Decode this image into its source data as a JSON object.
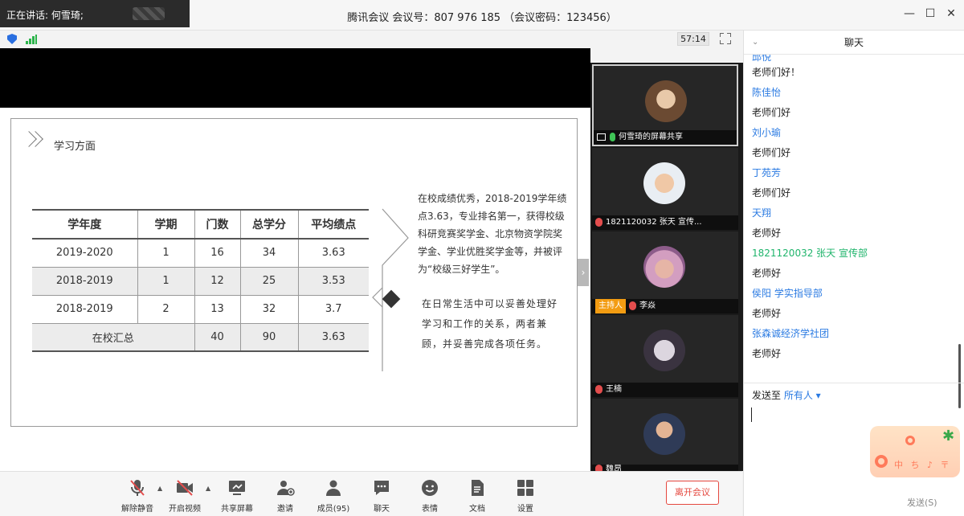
{
  "titlebar": {
    "speaking": "正在讲话: 何雪琦;",
    "meeting_title": "腾讯会议 会议号：807 976 185 （会议密码：123456）",
    "min_icon": "—",
    "max_icon": "☐",
    "close_icon": "✕"
  },
  "infobar": {
    "timer": "57:14"
  },
  "slide": {
    "section_title": "学习方面",
    "table": {
      "headers": [
        "学年度",
        "学期",
        "门数",
        "总学分",
        "平均绩点"
      ],
      "rows": [
        [
          "2019-2020",
          "1",
          "16",
          "34",
          "3.63"
        ],
        [
          "2018-2019",
          "1",
          "12",
          "25",
          "3.53"
        ],
        [
          "2018-2019",
          "2",
          "13",
          "32",
          "3.7"
        ]
      ],
      "summary": {
        "label": "在校汇总",
        "courses": "40",
        "credits": "90",
        "gpa": "3.63"
      }
    },
    "paragraph1": "在校成绩优秀，2018-2019学年绩点3.63，专业排名第一，获得校级科研竞赛奖学金、北京物资学院奖学金、学业优胜奖学金等，并被评为“校级三好学生”。",
    "paragraph2": "在日常生活中可以妥善处理好学习和工作的关系，两者兼顾，并妥善完成各项任务。",
    "next_arrow": "›"
  },
  "videos": [
    {
      "label": "何雪琦的屏幕共享",
      "active": true
    },
    {
      "label": "1821120032 张天 宣传..."
    },
    {
      "host_badge": "主持人",
      "label": "李焱"
    },
    {
      "label": "王楠"
    },
    {
      "label": "魏昂"
    }
  ],
  "toolbar": {
    "unmute": "解除静音",
    "video": "开启视频",
    "share": "共享屏幕",
    "invite": "邀请",
    "members": "成员(95)",
    "chat": "聊天",
    "emoji": "表情",
    "docs": "文档",
    "settings": "设置",
    "leave": "离开会议",
    "caret": "▲"
  },
  "chat": {
    "title": "聊天",
    "collapse": "⌄",
    "partial_sender": "邱悦",
    "messages": [
      {
        "sender": "",
        "text": "老师们好！"
      },
      {
        "sender": "陈佳怡",
        "text": "老师们好"
      },
      {
        "sender": "刘小瑜",
        "text": "老师们好"
      },
      {
        "sender": "丁苑芳",
        "text": "老师们好"
      },
      {
        "sender": "天翔",
        "text": "老师好"
      },
      {
        "sender": "1821120032 张天 宣传部",
        "text": "老师好",
        "green": true
      },
      {
        "sender": " 侯阳 学实指导部",
        "text": "老师好"
      },
      {
        "sender": "张森诚经济学社团",
        "text": "老师好"
      }
    ],
    "send_to_label": "发送至",
    "send_to_target": "所有人 ▾",
    "send_button": "发送(S)",
    "sticker_text": "中 ち ♪ 〒"
  },
  "colors": {
    "accent_blue": "#2a7ae2",
    "green_sender": "#1fb46b",
    "leave_red": "#e5483f",
    "host_orange": "#f39c12"
  }
}
